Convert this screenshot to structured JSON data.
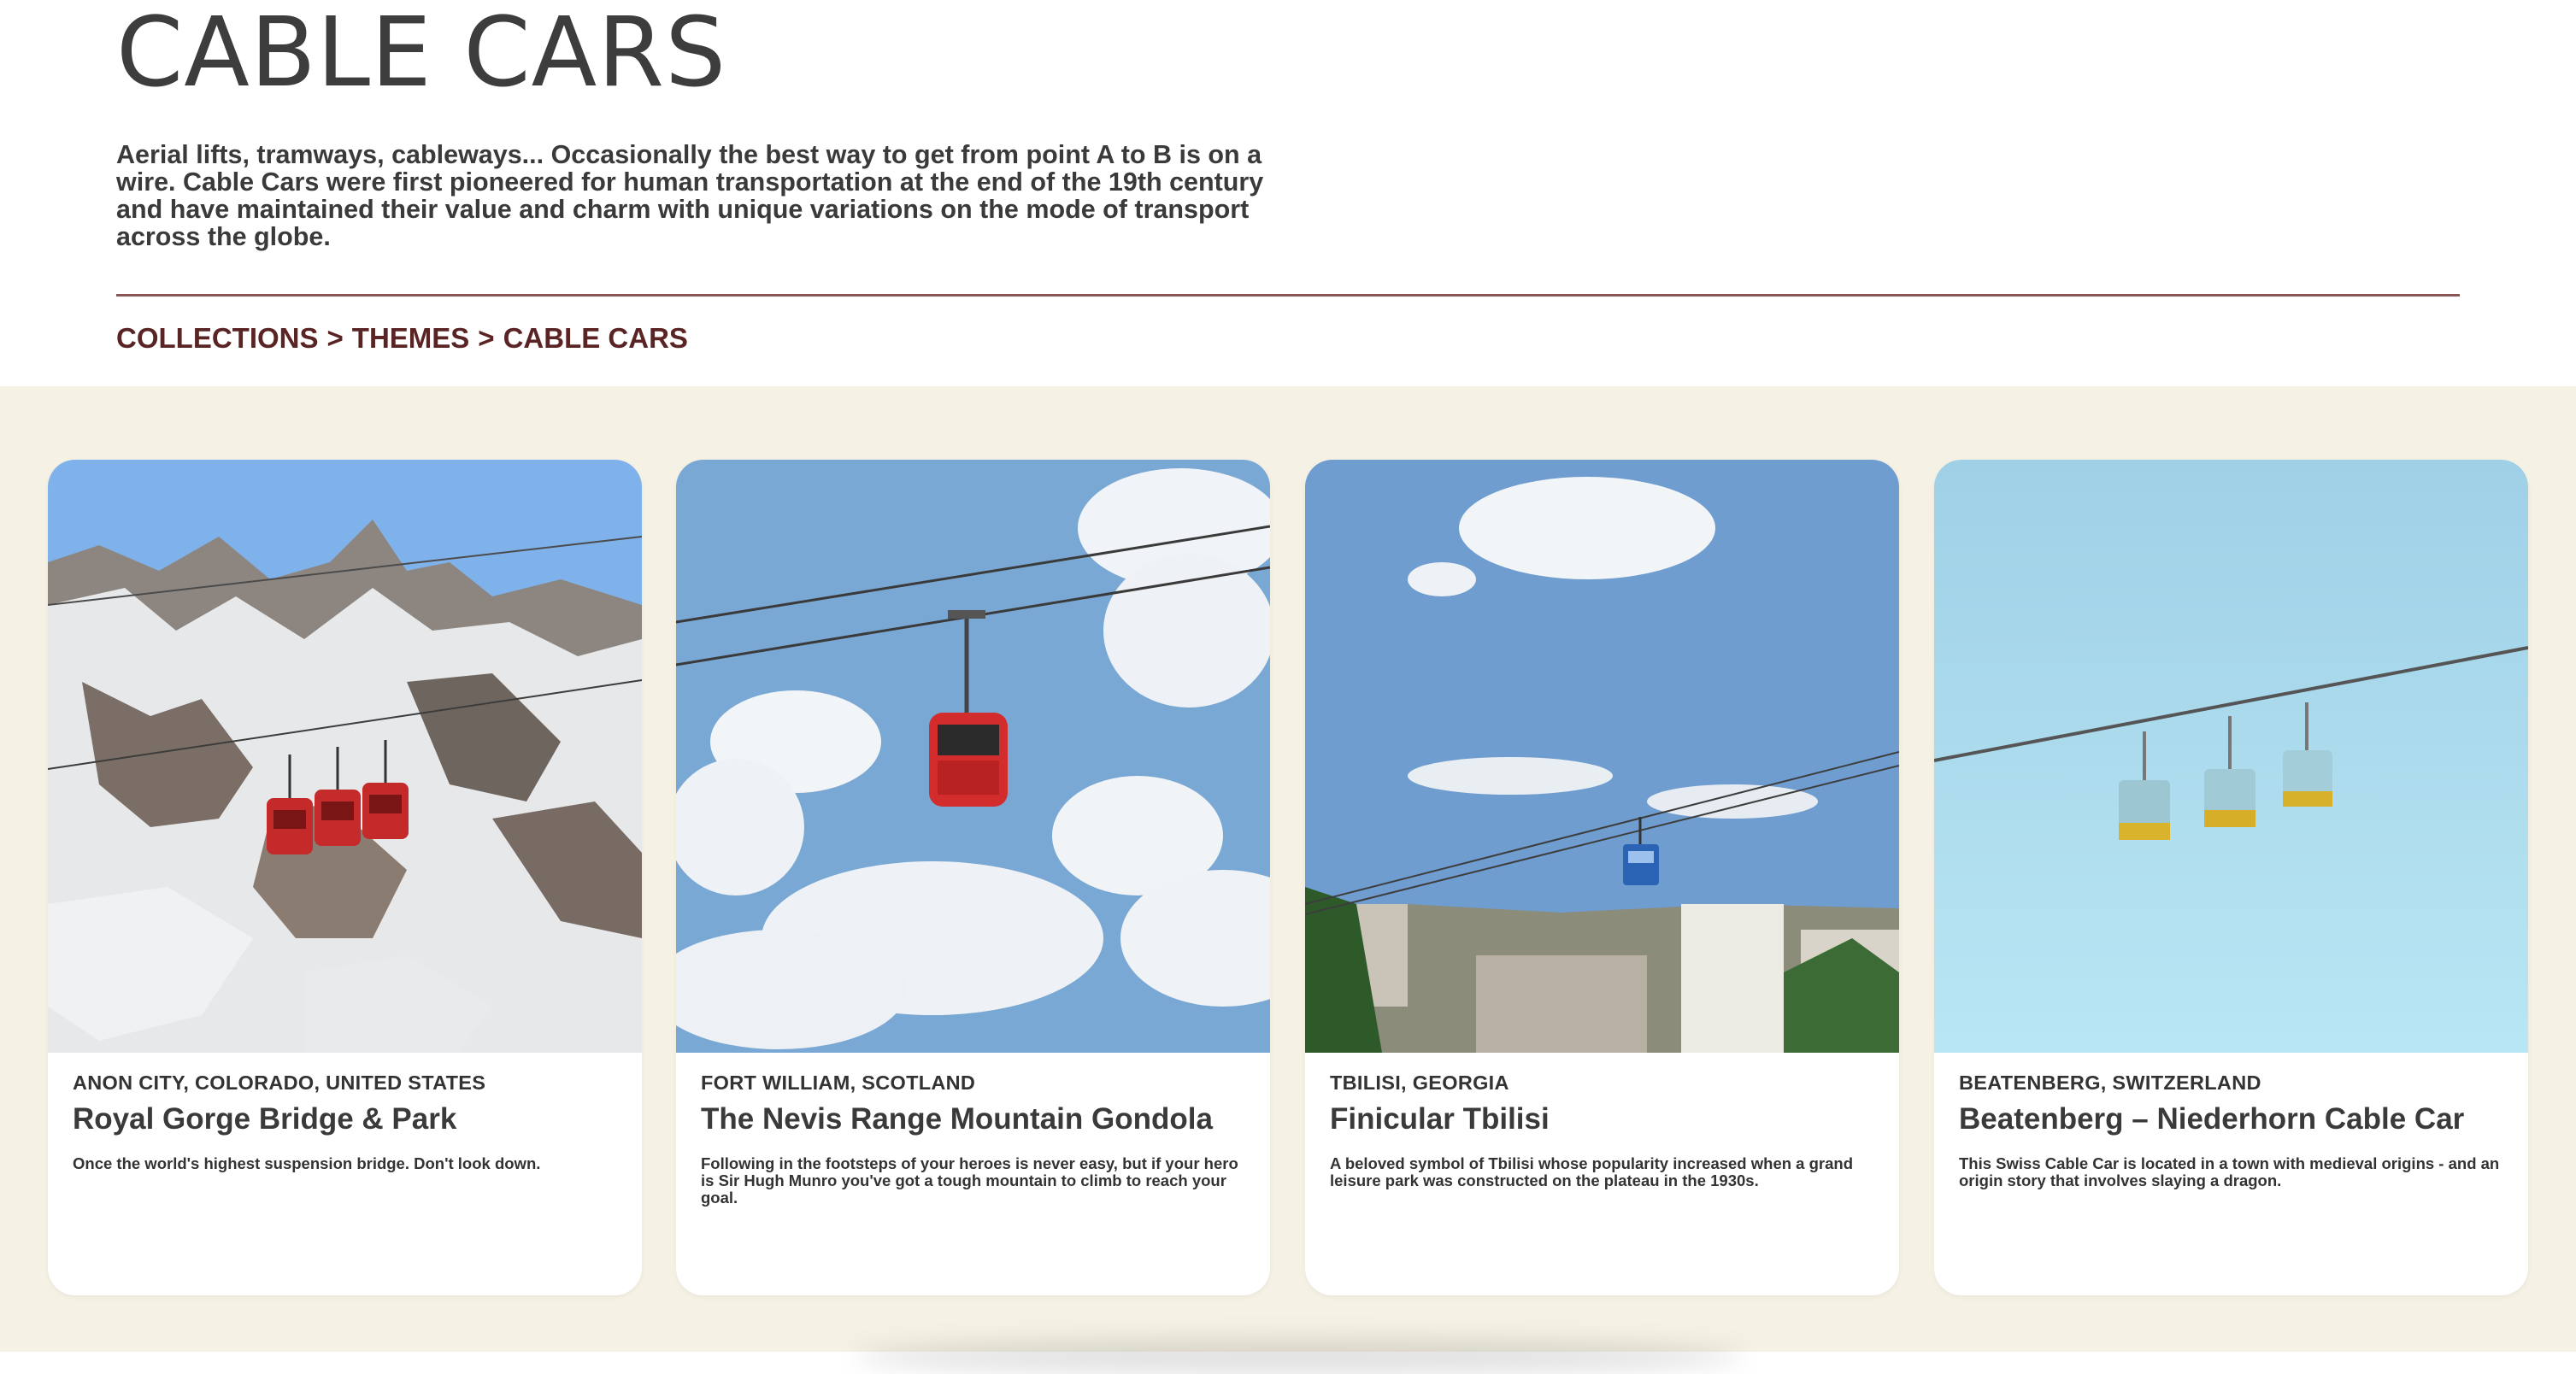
{
  "page": {
    "title": "CABLE CARS",
    "intro": "Aerial lifts, tramways, cableways... Occasionally the best way to get from point A to B is on a wire. Cable Cars were first pioneered for human transportation at the end of the 19th century and have maintained their value and charm with unique variations on the mode of transport across the globe."
  },
  "breadcrumb": {
    "items": [
      "COLLECTIONS",
      "THEMES",
      "CABLE CARS"
    ],
    "separator": ">"
  },
  "colors": {
    "title": "#3d3d3d",
    "accent": "#5a2424",
    "divider": "#8a5555",
    "catalog_background": "#f5f1e4",
    "card_background": "#ffffff"
  },
  "cards": [
    {
      "location": "ANON CITY, COLORADO, UNITED STATES",
      "title": "Royal Gorge Bridge & Park",
      "description": "Once the world's highest suspension bridge. Don't look down.",
      "image": "snowy-mountain-red-gondolas"
    },
    {
      "location": "FORT WILLIAM, SCOTLAND",
      "title": "The Nevis Range Mountain Gondola",
      "description": "Following in the footsteps of your heroes is never easy, but if your hero is Sir Hugh Munro you've got a tough mountain to climb to reach your goal.",
      "image": "red-gondola-cloudy-sky"
    },
    {
      "location": "TBILISI, GEORGIA",
      "title": "Finicular Tbilisi",
      "description": "A beloved symbol of Tbilisi whose popularity increased when a grand leisure park was constructed on the plateau in the 1930s.",
      "image": "blue-cabin-over-city"
    },
    {
      "location": "BEATENBERG, SWITZERLAND",
      "title": "Beatenberg – Niederhorn Cable Car",
      "description": "This Swiss Cable Car is located in a town with medieval origins - and an origin story that involves slaying a dragon.",
      "image": "three-yellow-gondolas-blue-sky"
    }
  ]
}
